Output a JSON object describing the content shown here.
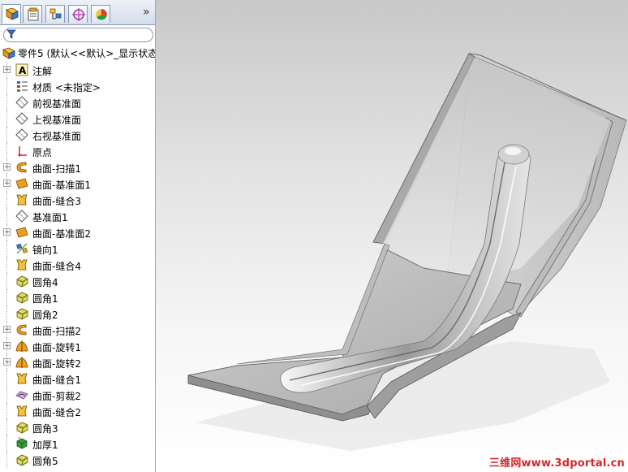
{
  "root": {
    "label": "零件5 (默认<<默认>_显示状态"
  },
  "filter": {
    "placeholder": ""
  },
  "tree": [
    {
      "label": "注解",
      "icon": "annotation-icon",
      "exp": true
    },
    {
      "label": "材质 <未指定>",
      "icon": "material-icon",
      "exp": false
    },
    {
      "label": "前视基准面",
      "icon": "plane-icon",
      "exp": false
    },
    {
      "label": "上视基准面",
      "icon": "plane-icon",
      "exp": false
    },
    {
      "label": "右视基准面",
      "icon": "plane-icon",
      "exp": false
    },
    {
      "label": "原点",
      "icon": "origin-icon",
      "exp": false
    },
    {
      "label": "曲面-扫描1",
      "icon": "surface-sweep-icon",
      "exp": true
    },
    {
      "label": "曲面-基准面1",
      "icon": "planar-surface-icon",
      "exp": true
    },
    {
      "label": "曲面-缝合3",
      "icon": "knit-surface-icon",
      "exp": false
    },
    {
      "label": "基准面1",
      "icon": "plane-icon",
      "exp": false
    },
    {
      "label": "曲面-基准面2",
      "icon": "planar-surface-icon",
      "exp": true
    },
    {
      "label": "镜向1",
      "icon": "mirror-icon",
      "exp": false
    },
    {
      "label": "曲面-缝合4",
      "icon": "knit-surface-icon",
      "exp": false
    },
    {
      "label": "圆角4",
      "icon": "fillet-icon",
      "exp": false
    },
    {
      "label": "圆角1",
      "icon": "fillet-icon",
      "exp": false
    },
    {
      "label": "圆角2",
      "icon": "fillet-icon",
      "exp": false
    },
    {
      "label": "曲面-扫描2",
      "icon": "surface-sweep-icon",
      "exp": true
    },
    {
      "label": "曲面-旋转1",
      "icon": "surface-revolve-icon",
      "exp": true
    },
    {
      "label": "曲面-旋转2",
      "icon": "surface-revolve-icon",
      "exp": true
    },
    {
      "label": "曲面-缝合1",
      "icon": "knit-surface-icon",
      "exp": false
    },
    {
      "label": "曲面-剪裁2",
      "icon": "trim-surface-icon",
      "exp": false
    },
    {
      "label": "曲面-缝合2",
      "icon": "knit-surface-icon",
      "exp": false
    },
    {
      "label": "圆角3",
      "icon": "fillet-icon",
      "exp": false
    },
    {
      "label": "加厚1",
      "icon": "thicken-icon",
      "exp": false
    },
    {
      "label": "圆角5",
      "icon": "fillet-icon",
      "exp": false
    }
  ],
  "watermark": "三维网www.3dportal.cn"
}
